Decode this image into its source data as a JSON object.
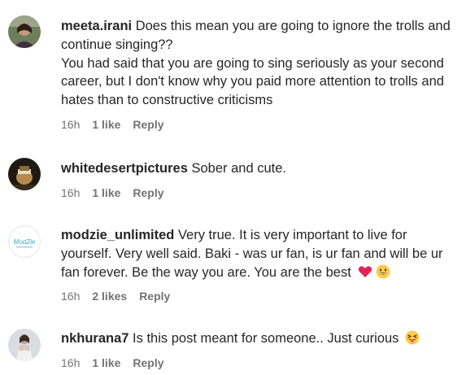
{
  "comments": [
    {
      "username": "meeta.irani",
      "text_line1": " Does this mean you are going to ignore the trolls and continue singing??",
      "text_rest": "You had said that you are going to sing seriously as your second career, but I don't know why you paid more attention to trolls and hates than to constructive criticisms",
      "time": "16h",
      "likes": "1 like",
      "reply": "Reply"
    },
    {
      "username": "whitedesertpictures",
      "text_line1": " Sober and cute.",
      "time": "16h",
      "likes": "1 like",
      "reply": "Reply"
    },
    {
      "username": "modzie_unlimited",
      "text_line1": " Very true. It is very important to live for yourself. Very well said. Baki - was ur fan, is ur fan and will be ur fan forever. Be the way you are. You are the best",
      "emojis": [
        "red-heart",
        "grinning-face"
      ],
      "avatar_text": "ModZie",
      "time": "16h",
      "likes": "2 likes",
      "reply": "Reply"
    },
    {
      "username": "nkhurana7",
      "text_line1": " Is this post meant for someone.. Just curious",
      "emojis": [
        "face-with-tongue"
      ],
      "time": "16h",
      "likes": "1 like",
      "reply": "Reply"
    }
  ],
  "colors": {
    "text": "#262626",
    "meta": "#737373",
    "background": "#ffffff",
    "heart": "#e0245e",
    "emoji_yellow": "#ffcc4d"
  }
}
